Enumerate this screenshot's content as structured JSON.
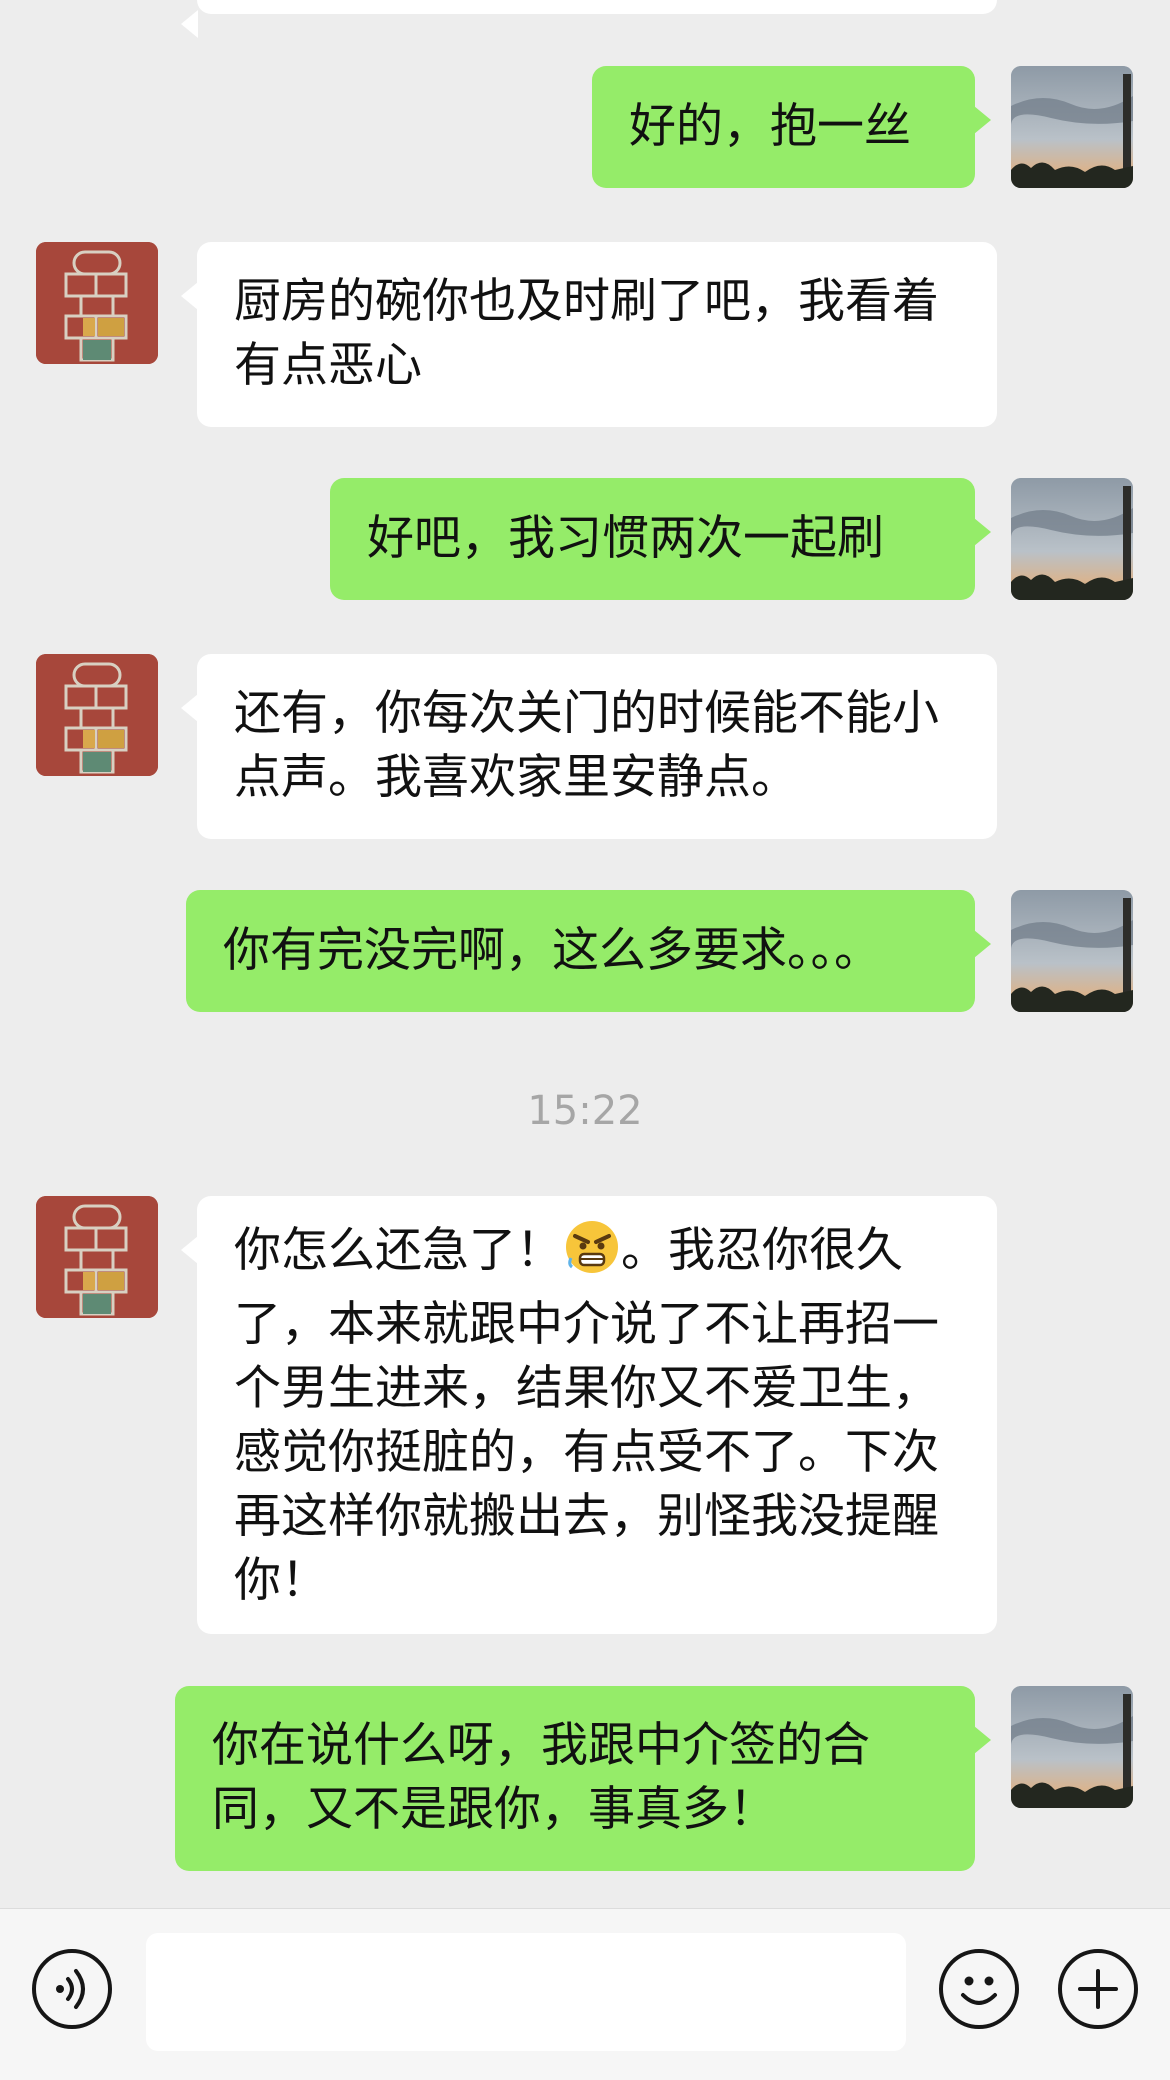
{
  "messages": [
    {
      "sender": "self",
      "text": "好的，抱一丝"
    },
    {
      "sender": "other",
      "text": "厨房的碗你也及时刷了吧，我看着有点恶心"
    },
    {
      "sender": "self",
      "text": "好吧，我习惯两次一起刷"
    },
    {
      "sender": "other",
      "text": "还有，你每次关门的时候能不能小点声。我喜欢家里安静点。"
    },
    {
      "sender": "self",
      "text": "你有完没完啊，这么多要求。。。"
    },
    {
      "sender": "other",
      "text_before": "你怎么还急了！",
      "emoji": "angry-face-emoji",
      "text_after": "。我忍你很久了，本来就跟中介说了不让再招一个男生进来，结果你又不爱卫生，感觉你挺脏的，有点受不了。下次再这样你就搬出去，别怪我没提醒你！"
    },
    {
      "sender": "self",
      "text": "你在说什么呀，我跟中介签的合同，又不是跟你，事真多！"
    }
  ],
  "timestamp": "15:22",
  "input_bar": {
    "voice_icon": "voice-icon",
    "emoji_icon": "emoji-icon",
    "plus_icon": "plus-icon",
    "input_value": ""
  },
  "colors": {
    "background": "#ededed",
    "self_bubble": "#95ec69",
    "other_bubble": "#ffffff",
    "timestamp": "#a6a6a6"
  }
}
